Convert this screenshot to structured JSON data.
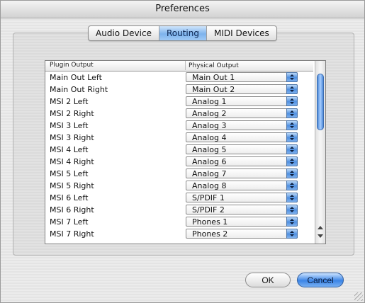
{
  "window": {
    "title": "Preferences"
  },
  "tabs": [
    {
      "label": "Audio Device",
      "active": false
    },
    {
      "label": "Routing",
      "active": true
    },
    {
      "label": "MIDI Devices",
      "active": false
    }
  ],
  "table": {
    "headers": {
      "plugin_output": "Plugin Output",
      "physical_output": "Physical Output"
    },
    "rows": [
      {
        "plugin": "Main Out Left",
        "physical": "Main Out 1"
      },
      {
        "plugin": "Main Out Right",
        "physical": "Main Out 2"
      },
      {
        "plugin": "MSI 2 Left",
        "physical": "Analog 1"
      },
      {
        "plugin": "MSI 2 Right",
        "physical": "Analog 2"
      },
      {
        "plugin": "MSI 3 Left",
        "physical": "Analog 3"
      },
      {
        "plugin": "MSI 3 Right",
        "physical": "Analog 4"
      },
      {
        "plugin": "MSI 4 Left",
        "physical": "Analog 5"
      },
      {
        "plugin": "MSI 4 Right",
        "physical": "Analog 6"
      },
      {
        "plugin": "MSI 5 Left",
        "physical": "Analog 7"
      },
      {
        "plugin": "MSI 5 Right",
        "physical": "Analog 8"
      },
      {
        "plugin": "MSI 6 Left",
        "physical": "S/PDIF 1"
      },
      {
        "plugin": "MSI 6 Right",
        "physical": "S/PDIF 2"
      },
      {
        "plugin": "MSI 7 Left",
        "physical": "Phones 1"
      },
      {
        "plugin": "MSI 7 Right",
        "physical": "Phones 2"
      }
    ]
  },
  "buttons": {
    "ok": "OK",
    "cancel": "Cancel"
  }
}
